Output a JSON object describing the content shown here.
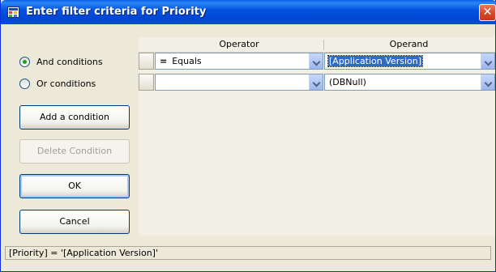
{
  "window": {
    "title": "Enter filter criteria for Priority"
  },
  "conditions": {
    "and_label": "And conditions",
    "or_label": "Or conditions",
    "selected": "and"
  },
  "buttons": {
    "add_condition": "Add a condition",
    "delete_condition": "Delete Condition",
    "ok": "OK",
    "cancel": "Cancel"
  },
  "grid": {
    "columns": [
      "Operator",
      "Operand"
    ],
    "rows": [
      {
        "operator_symbol": "=",
        "operator": "Equals",
        "operand": "[Application Version]"
      },
      {
        "operator_symbol": "",
        "operator": "",
        "operand": "(DBNull)"
      }
    ]
  },
  "status": {
    "expression": "[Priority] = '[Application Version]'"
  },
  "colors": {
    "title_bar": "#0553e0",
    "dialog_bg": "#ece9d8",
    "selection": "#316ac5",
    "radio_dot": "#21a121"
  },
  "icons": {
    "app": "filter-dialog-icon",
    "close": "close-icon",
    "dropdown": "chevron-down-icon"
  }
}
